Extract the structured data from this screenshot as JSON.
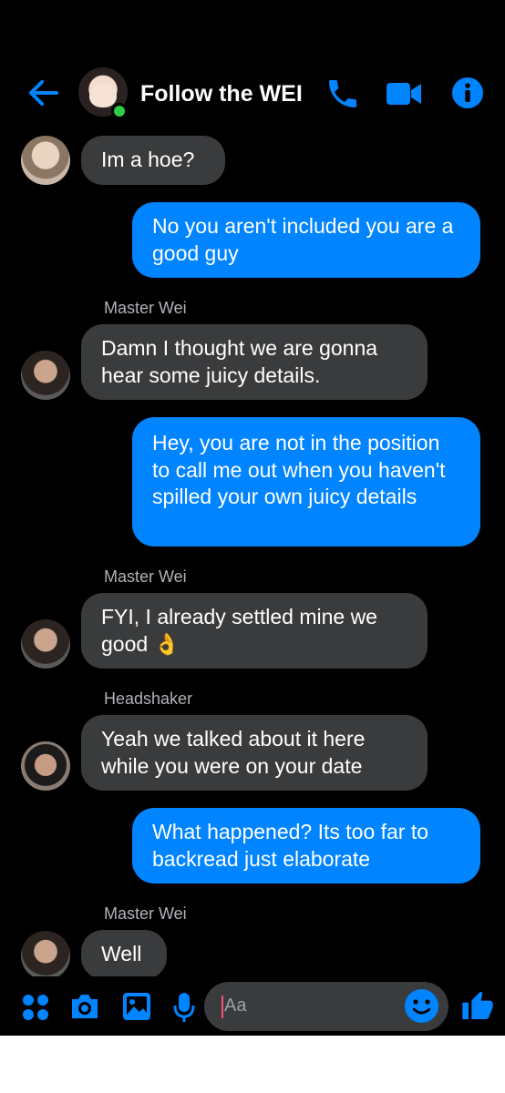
{
  "header": {
    "title": "Follow the WEI",
    "accent_color": "#0084ff",
    "online_color": "#31cc46",
    "icons": [
      "back-arrow-icon",
      "phone-icon",
      "video-camera-icon",
      "info-icon"
    ]
  },
  "messages": [
    {
      "type": "received",
      "text": "Im a hoe?",
      "avatar": "avatar-a"
    },
    {
      "type": "sent",
      "text": "No you aren't included you are a good guy"
    },
    {
      "type": "received",
      "sender": "Master Wei",
      "text": "Damn I thought we are gonna hear some juicy details.",
      "avatar": "avatar-b"
    },
    {
      "type": "sent",
      "text": "Hey, you are not in the position to call me out when you haven't spilled your own juicy details"
    },
    {
      "type": "received",
      "sender": "Master Wei",
      "text": "FYI, I already settled mine we good",
      "emoji": "👌",
      "avatar": "avatar-b"
    },
    {
      "type": "received",
      "sender": "Headshaker",
      "text": "Yeah we talked about it here while you were on your date",
      "avatar": "avatar-c"
    },
    {
      "type": "sent",
      "text": "What happened? Its too far to backread just elaborate"
    },
    {
      "type": "received",
      "sender": "Master Wei",
      "text": "Well",
      "avatar": "avatar-b"
    }
  ],
  "composer": {
    "placeholder": "Aa",
    "icons": [
      "apps-grid-icon",
      "camera-icon",
      "image-icon",
      "microphone-icon",
      "emoji-icon",
      "thumbs-up-icon"
    ]
  },
  "colors": {
    "background": "#000000",
    "received_bubble": "#3a3b3c",
    "sent_bubble": "#0084ff",
    "sender_name": "#b0b3b8"
  }
}
